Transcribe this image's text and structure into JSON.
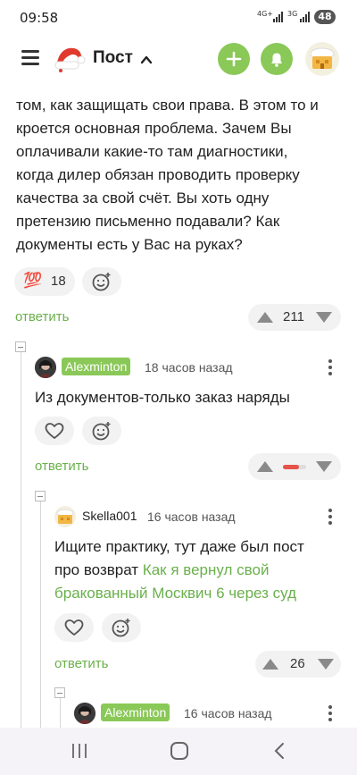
{
  "status": {
    "time": "09:58",
    "net1": "4G+",
    "net2": "3G",
    "battery": "48"
  },
  "header": {
    "title": "Пост"
  },
  "comment0": {
    "lines": [
      "том, как защищать свои права. В этом то и",
      "кроется основная проблема. Зачем Вы",
      "оплачивали какие-то там диагностики,",
      "когда дилер обязан проводить проверку",
      "качества за свой счёт. Вы хоть одну",
      "претензию письменно подавали? Как",
      "документы есть у Вас на руках?"
    ],
    "reaction_emoji": "💯",
    "reaction_count": "18",
    "reply": "ответить",
    "rating": "211"
  },
  "comment1": {
    "user": "Alexminton",
    "time": "18 часов назад",
    "text": "Из документов-только заказ наряды",
    "reply": "ответить"
  },
  "comment2": {
    "user": "Skella001",
    "time": "16 часов назад",
    "text_line1": "Ищите практику, тут даже был пост",
    "text_line2_prefix": "про возврат ",
    "link_part1": "Как я вернул свой",
    "link_part2": "бракованный Москвич 6 через суд",
    "reply": "ответить",
    "rating": "26"
  },
  "comment3": {
    "user": "Alexminton",
    "time": "16 часов назад"
  },
  "colors": {
    "accent": "#8ac858",
    "link": "#6ab04c",
    "danger": "#e5534b"
  },
  "icons": [
    "menu-icon",
    "santa-hat-logo-icon",
    "chevron-up-icon",
    "plus-icon",
    "bell-icon",
    "heart-icon",
    "emoji-add-icon",
    "arrow-up-icon",
    "arrow-down-icon",
    "more-icon",
    "back-icon",
    "home-icon",
    "recents-icon"
  ]
}
